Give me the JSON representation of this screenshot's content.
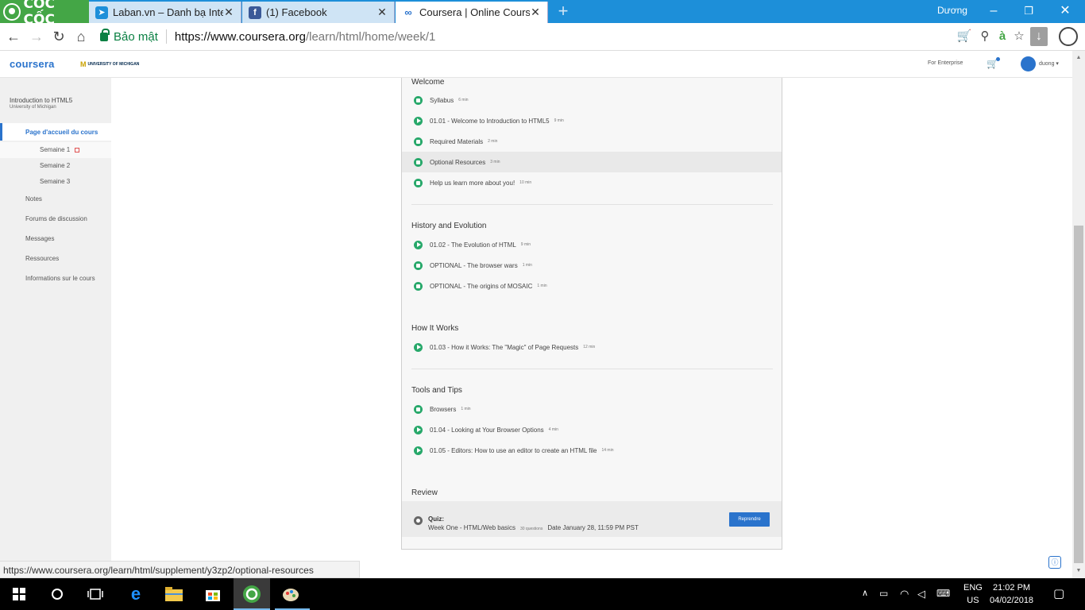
{
  "browser": {
    "brand_name": "CỐC CỐC",
    "tabs": [
      {
        "title": "Laban.vn – Danh bạ Interr",
        "icon": "compass-icon",
        "color": "#1d8fd9"
      },
      {
        "title": "(1) Facebook",
        "icon": "facebook-icon",
        "color": "#3b5998"
      },
      {
        "title": "Coursera | Online Courses",
        "icon": "coursera-icon",
        "color": "#2a73cc"
      }
    ],
    "window_user": "Dương",
    "secure_label": "Bảo mật",
    "url_host": "https://www.coursera.org",
    "url_path": "/learn/html/home/week/1"
  },
  "site": {
    "logo": "coursera",
    "partner": "UNIVERSITY OF MICHIGAN",
    "enterprise_link": "For Enterprise",
    "username": "duong ▾"
  },
  "sidebar": {
    "course_title": "Introduction to HTML5",
    "course_university": "University of Michigan",
    "home_label": "Page d'accueil du cours",
    "weeks": [
      "Semaine 1",
      "Semaine 2",
      "Semaine 3"
    ],
    "links": [
      "Notes",
      "Forums de discussion",
      "Messages",
      "Ressources",
      "Informations sur le cours"
    ]
  },
  "main": {
    "sections": [
      {
        "title": "Welcome",
        "items": [
          {
            "name": "Syllabus",
            "duration": "6 min",
            "kind": "doc"
          },
          {
            "name": "01.01 - Welcome to Introduction to HTML5",
            "duration": "9 min",
            "kind": "play"
          },
          {
            "name": "Required Materials",
            "duration": "2 min",
            "kind": "doc"
          },
          {
            "name": "Optional Resources",
            "duration": "3 min",
            "kind": "doc"
          },
          {
            "name": "Help us learn more about you!",
            "duration": "10 min",
            "kind": "doc"
          }
        ]
      },
      {
        "title": "History and Evolution",
        "items": [
          {
            "name": "01.02 - The Evolution of HTML",
            "duration": "9 min",
            "kind": "play"
          },
          {
            "name": "OPTIONAL - The browser wars",
            "duration": "1 min",
            "kind": "doc"
          },
          {
            "name": "OPTIONAL - The origins of MOSAIC",
            "duration": "1 min",
            "kind": "doc"
          }
        ]
      },
      {
        "title": "How It Works",
        "items": [
          {
            "name": "01.03 - How it Works: The \"Magic\" of Page Requests",
            "duration": "12 min",
            "kind": "play"
          }
        ]
      },
      {
        "title": "Tools and Tips",
        "items": [
          {
            "name": "Browsers",
            "duration": "1 min",
            "kind": "doc"
          },
          {
            "name": "01.04 - Looking at Your Browser Options",
            "duration": "4 min",
            "kind": "play"
          },
          {
            "name": "01.05 - Editors: How to use an editor to create an HTML file",
            "duration": "14 min",
            "kind": "play"
          }
        ]
      },
      {
        "title": "Review",
        "items": []
      }
    ],
    "quiz": {
      "label": "Quiz:",
      "name": "Week One - HTML/Web basics",
      "questions": "30 questions",
      "date": "Date January 28, 11:59 PM PST",
      "button": "Reprendre"
    }
  },
  "status_url": "https://www.coursera.org/learn/html/supplement/y3zp2/optional-resources",
  "taskbar": {
    "lang_top": "ENG",
    "lang_bottom": "US",
    "time": "21:02 PM",
    "date": "04/02/2018"
  }
}
